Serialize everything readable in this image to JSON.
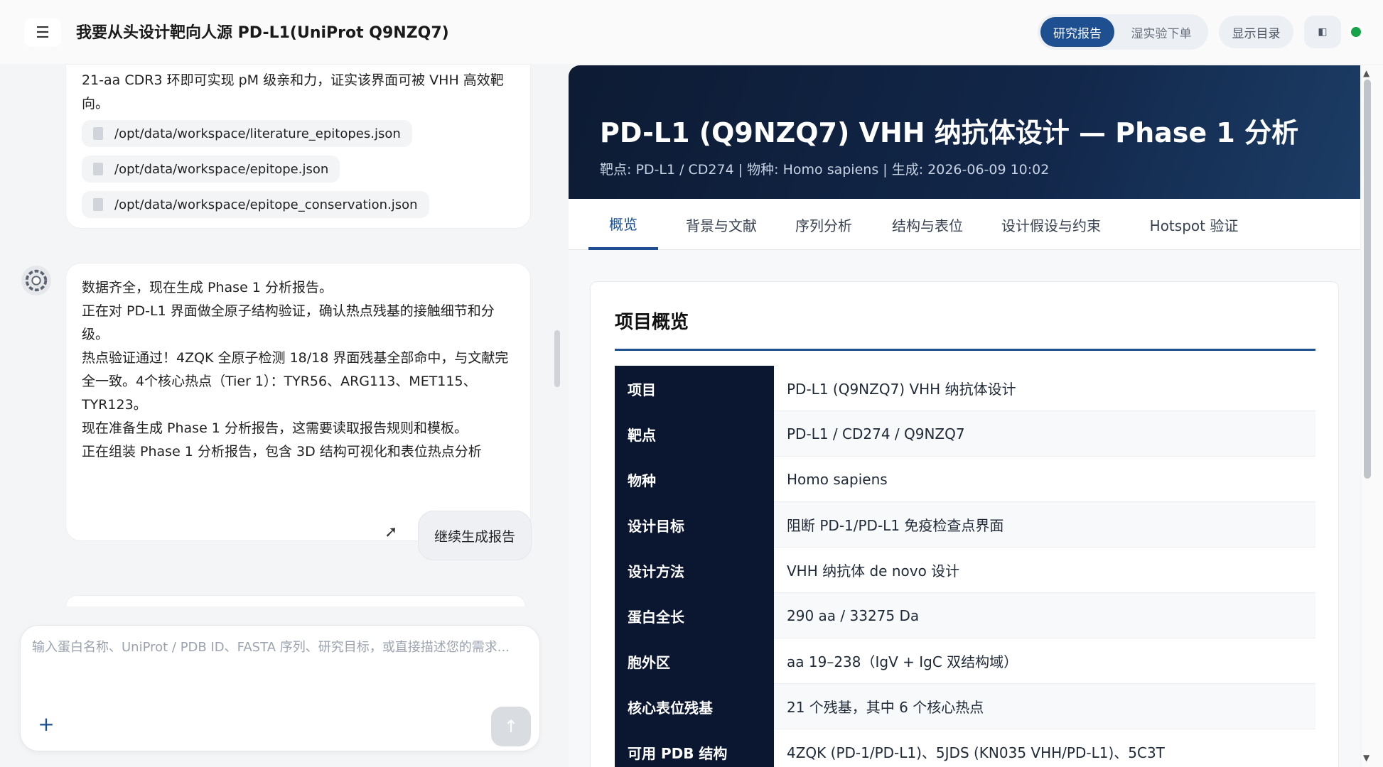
{
  "header": {
    "title": "我要从头设计靶向人源 PD-L1(UniProt Q9NZQ7)",
    "menu_icon": "☰",
    "mode_tabs": [
      "研究报告",
      "湿实验下单"
    ],
    "toc_button": "显示目录",
    "panel_icon": "◧",
    "status_color": "#16a34a"
  },
  "chat": {
    "msg1_text": "21-aa CDR3 环即可实现 pM 级亲和力，证实该界面可被 VHH 高效靶向。",
    "files": [
      "/opt/data/workspace/literature_epitopes.json",
      "/opt/data/workspace/epitope.json",
      "/opt/data/workspace/epitope_conservation.json"
    ],
    "msg2_lines": [
      "数据齐全，现在生成 Phase 1 分析报告。",
      "正在对 PD-L1 界面做全原子结构验证，确认热点残基的接触细节和分级。",
      "热点验证通过！4ZQK 全原子检测 18/18 界面残基全部命中，与文献完全一致。4个核心热点（Tier 1）：TYR56、ARG113、MET115、TYR123。",
      "现在准备生成 Phase 1 分析报告，这需要读取报告规则和模板。",
      "正在组装 Phase 1 分析报告，包含 3D 结构可视化和表位热点分析"
    ],
    "user_msg": "继续生成报告"
  },
  "composer": {
    "placeholder": "输入蛋白名称、UniProt / PDB ID、FASTA 序列、研究目标，或直接描述您的需求...",
    "plus": "+",
    "send": "↑"
  },
  "report": {
    "title": "PD-L1 (Q9NZQ7) VHH 纳抗体设计 — Phase 1 分析",
    "meta": "靶点: PD-L1 / CD274 | 物种: Homo sapiens | 生成: 2026-06-09 10:02",
    "tabs": [
      "概览",
      "背景与文献",
      "序列分析",
      "结构与表位",
      "设计假设与约束",
      "Hotspot 验证"
    ],
    "section_title": "项目概览",
    "overview": [
      {
        "key": "项目",
        "value": "PD-L1 (Q9NZQ7) VHH 纳抗体设计"
      },
      {
        "key": "靶点",
        "value": "PD-L1 / CD274 / Q9NZQ7"
      },
      {
        "key": "物种",
        "value": "Homo sapiens"
      },
      {
        "key": "设计目标",
        "value": "阻断 PD-1/PD-L1 免疫检查点界面"
      },
      {
        "key": "设计方法",
        "value": "VHH 纳抗体 de novo 设计"
      },
      {
        "key": "蛋白全长",
        "value": "290 aa / 33275 Da"
      },
      {
        "key": "胞外区",
        "value": "aa 19–238（IgV + IgC 双结构域）"
      },
      {
        "key": "核心表位残基",
        "value": "21 个残基，其中 6 个核心热点"
      },
      {
        "key": "可用 PDB 结构",
        "value": "4ZQK (PD-1/PD-L1)、5JDS (KN035 VHH/PD-L1)、5C3T"
      }
    ]
  },
  "colors": {
    "accent": "#1d4f91",
    "hero_dark": "#0d1b33",
    "table_key_bg": "#0b1730"
  }
}
